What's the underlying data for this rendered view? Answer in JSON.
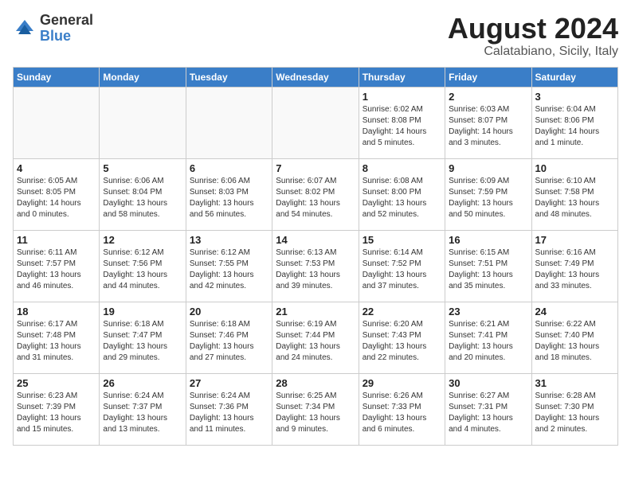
{
  "logo": {
    "general": "General",
    "blue": "Blue"
  },
  "title": {
    "month": "August 2024",
    "location": "Calatabiano, Sicily, Italy"
  },
  "weekdays": [
    "Sunday",
    "Monday",
    "Tuesday",
    "Wednesday",
    "Thursday",
    "Friday",
    "Saturday"
  ],
  "weeks": [
    [
      {
        "day": "",
        "sunrise": "",
        "sunset": "",
        "daylight": "",
        "empty": true
      },
      {
        "day": "",
        "sunrise": "",
        "sunset": "",
        "daylight": "",
        "empty": true
      },
      {
        "day": "",
        "sunrise": "",
        "sunset": "",
        "daylight": "",
        "empty": true
      },
      {
        "day": "",
        "sunrise": "",
        "sunset": "",
        "daylight": "",
        "empty": true
      },
      {
        "day": "1",
        "sunrise": "Sunrise: 6:02 AM",
        "sunset": "Sunset: 8:08 PM",
        "daylight": "Daylight: 14 hours and 5 minutes."
      },
      {
        "day": "2",
        "sunrise": "Sunrise: 6:03 AM",
        "sunset": "Sunset: 8:07 PM",
        "daylight": "Daylight: 14 hours and 3 minutes."
      },
      {
        "day": "3",
        "sunrise": "Sunrise: 6:04 AM",
        "sunset": "Sunset: 8:06 PM",
        "daylight": "Daylight: 14 hours and 1 minute."
      }
    ],
    [
      {
        "day": "4",
        "sunrise": "Sunrise: 6:05 AM",
        "sunset": "Sunset: 8:05 PM",
        "daylight": "Daylight: 14 hours and 0 minutes."
      },
      {
        "day": "5",
        "sunrise": "Sunrise: 6:06 AM",
        "sunset": "Sunset: 8:04 PM",
        "daylight": "Daylight: 13 hours and 58 minutes."
      },
      {
        "day": "6",
        "sunrise": "Sunrise: 6:06 AM",
        "sunset": "Sunset: 8:03 PM",
        "daylight": "Daylight: 13 hours and 56 minutes."
      },
      {
        "day": "7",
        "sunrise": "Sunrise: 6:07 AM",
        "sunset": "Sunset: 8:02 PM",
        "daylight": "Daylight: 13 hours and 54 minutes."
      },
      {
        "day": "8",
        "sunrise": "Sunrise: 6:08 AM",
        "sunset": "Sunset: 8:00 PM",
        "daylight": "Daylight: 13 hours and 52 minutes."
      },
      {
        "day": "9",
        "sunrise": "Sunrise: 6:09 AM",
        "sunset": "Sunset: 7:59 PM",
        "daylight": "Daylight: 13 hours and 50 minutes."
      },
      {
        "day": "10",
        "sunrise": "Sunrise: 6:10 AM",
        "sunset": "Sunset: 7:58 PM",
        "daylight": "Daylight: 13 hours and 48 minutes."
      }
    ],
    [
      {
        "day": "11",
        "sunrise": "Sunrise: 6:11 AM",
        "sunset": "Sunset: 7:57 PM",
        "daylight": "Daylight: 13 hours and 46 minutes."
      },
      {
        "day": "12",
        "sunrise": "Sunrise: 6:12 AM",
        "sunset": "Sunset: 7:56 PM",
        "daylight": "Daylight: 13 hours and 44 minutes."
      },
      {
        "day": "13",
        "sunrise": "Sunrise: 6:12 AM",
        "sunset": "Sunset: 7:55 PM",
        "daylight": "Daylight: 13 hours and 42 minutes."
      },
      {
        "day": "14",
        "sunrise": "Sunrise: 6:13 AM",
        "sunset": "Sunset: 7:53 PM",
        "daylight": "Daylight: 13 hours and 39 minutes."
      },
      {
        "day": "15",
        "sunrise": "Sunrise: 6:14 AM",
        "sunset": "Sunset: 7:52 PM",
        "daylight": "Daylight: 13 hours and 37 minutes."
      },
      {
        "day": "16",
        "sunrise": "Sunrise: 6:15 AM",
        "sunset": "Sunset: 7:51 PM",
        "daylight": "Daylight: 13 hours and 35 minutes."
      },
      {
        "day": "17",
        "sunrise": "Sunrise: 6:16 AM",
        "sunset": "Sunset: 7:49 PM",
        "daylight": "Daylight: 13 hours and 33 minutes."
      }
    ],
    [
      {
        "day": "18",
        "sunrise": "Sunrise: 6:17 AM",
        "sunset": "Sunset: 7:48 PM",
        "daylight": "Daylight: 13 hours and 31 minutes."
      },
      {
        "day": "19",
        "sunrise": "Sunrise: 6:18 AM",
        "sunset": "Sunset: 7:47 PM",
        "daylight": "Daylight: 13 hours and 29 minutes."
      },
      {
        "day": "20",
        "sunrise": "Sunrise: 6:18 AM",
        "sunset": "Sunset: 7:46 PM",
        "daylight": "Daylight: 13 hours and 27 minutes."
      },
      {
        "day": "21",
        "sunrise": "Sunrise: 6:19 AM",
        "sunset": "Sunset: 7:44 PM",
        "daylight": "Daylight: 13 hours and 24 minutes."
      },
      {
        "day": "22",
        "sunrise": "Sunrise: 6:20 AM",
        "sunset": "Sunset: 7:43 PM",
        "daylight": "Daylight: 13 hours and 22 minutes."
      },
      {
        "day": "23",
        "sunrise": "Sunrise: 6:21 AM",
        "sunset": "Sunset: 7:41 PM",
        "daylight": "Daylight: 13 hours and 20 minutes."
      },
      {
        "day": "24",
        "sunrise": "Sunrise: 6:22 AM",
        "sunset": "Sunset: 7:40 PM",
        "daylight": "Daylight: 13 hours and 18 minutes."
      }
    ],
    [
      {
        "day": "25",
        "sunrise": "Sunrise: 6:23 AM",
        "sunset": "Sunset: 7:39 PM",
        "daylight": "Daylight: 13 hours and 15 minutes."
      },
      {
        "day": "26",
        "sunrise": "Sunrise: 6:24 AM",
        "sunset": "Sunset: 7:37 PM",
        "daylight": "Daylight: 13 hours and 13 minutes."
      },
      {
        "day": "27",
        "sunrise": "Sunrise: 6:24 AM",
        "sunset": "Sunset: 7:36 PM",
        "daylight": "Daylight: 13 hours and 11 minutes."
      },
      {
        "day": "28",
        "sunrise": "Sunrise: 6:25 AM",
        "sunset": "Sunset: 7:34 PM",
        "daylight": "Daylight: 13 hours and 9 minutes."
      },
      {
        "day": "29",
        "sunrise": "Sunrise: 6:26 AM",
        "sunset": "Sunset: 7:33 PM",
        "daylight": "Daylight: 13 hours and 6 minutes."
      },
      {
        "day": "30",
        "sunrise": "Sunrise: 6:27 AM",
        "sunset": "Sunset: 7:31 PM",
        "daylight": "Daylight: 13 hours and 4 minutes."
      },
      {
        "day": "31",
        "sunrise": "Sunrise: 6:28 AM",
        "sunset": "Sunset: 7:30 PM",
        "daylight": "Daylight: 13 hours and 2 minutes."
      }
    ]
  ]
}
